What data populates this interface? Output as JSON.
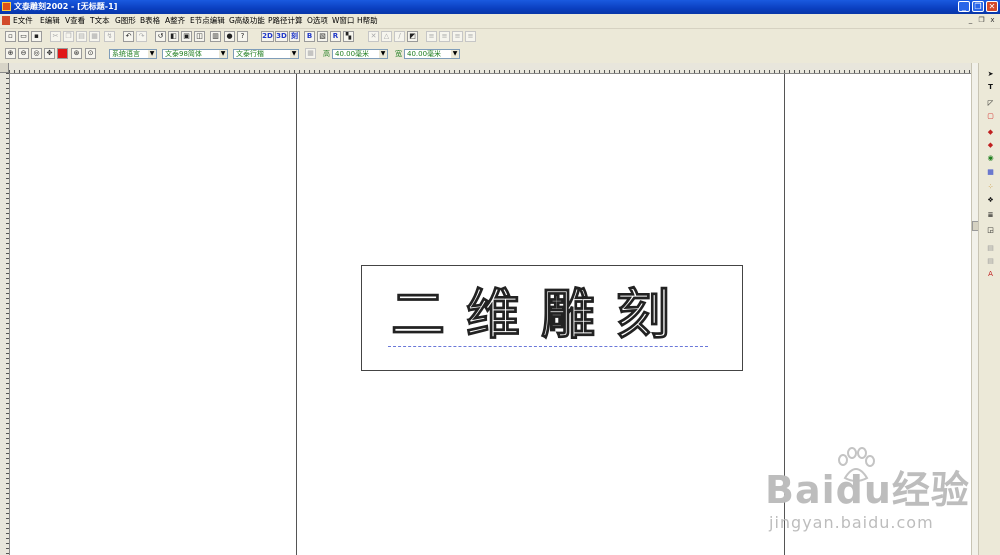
{
  "window": {
    "title": "文泰雕刻2002 - [无标题-1]",
    "minimize_glyph": "_",
    "restore_glyph": "❐",
    "close_glyph": "✕"
  },
  "menu": {
    "items": [
      "E文件",
      "E编辑",
      "V查看",
      "T文本",
      "G图形",
      "B表格",
      "A整齐",
      "E节点编辑",
      "G高级功能",
      "P路径计算",
      "O选项",
      "W窗口",
      "H帮助"
    ],
    "mdi_minimize": "_",
    "mdi_restore": "❐",
    "mdi_close": "x"
  },
  "toolbar1": {
    "btn_2d": "2D",
    "btn_3d": "3D",
    "btn_engrave": "刻",
    "btn_b": "B",
    "btn_r": "R"
  },
  "toolbar2": {
    "language": "系统语言",
    "font": "文泰98简体",
    "line_mode": "文泰行楷",
    "height_label": "高",
    "height_value": "40.00毫米",
    "width_label": "宽",
    "width_value": "40.00毫米"
  },
  "canvas": {
    "engraved_text": "二维雕刻"
  },
  "watermark": {
    "brand": "Baidu经验",
    "url": "jingyan.baidu.com"
  },
  "colors": {
    "titlebar": "#0a3fc0",
    "chrome": "#ece9d8",
    "baseline": "#6a78d8",
    "combo_text": "#1e7d1e"
  },
  "icons": {
    "toolbar1": [
      "new-file-icon",
      "open-file-icon",
      "save-icon",
      "cut-icon",
      "copy-icon",
      "paste-icon",
      "delete-icon",
      "undo-icon",
      "redo-icon",
      "import-icon",
      "export-icon",
      "print-icon",
      "print-preview-icon",
      "scan-icon",
      "bulb-icon",
      "help-icon"
    ],
    "toolbar2": [
      "zoom-in-icon",
      "zoom-out-icon",
      "zoom-select-icon",
      "pan-icon",
      "color-icon",
      "zoom-page-icon",
      "zoom-all-icon"
    ],
    "right": [
      "pointer-icon",
      "text-tool-icon",
      "node-edit-icon",
      "rectangle-icon",
      "fill-icon",
      "color-fill-icon",
      "shape-icon",
      "table-icon",
      "palette-icon",
      "special-effect-icon",
      "align-icon",
      "layer-icon"
    ]
  }
}
